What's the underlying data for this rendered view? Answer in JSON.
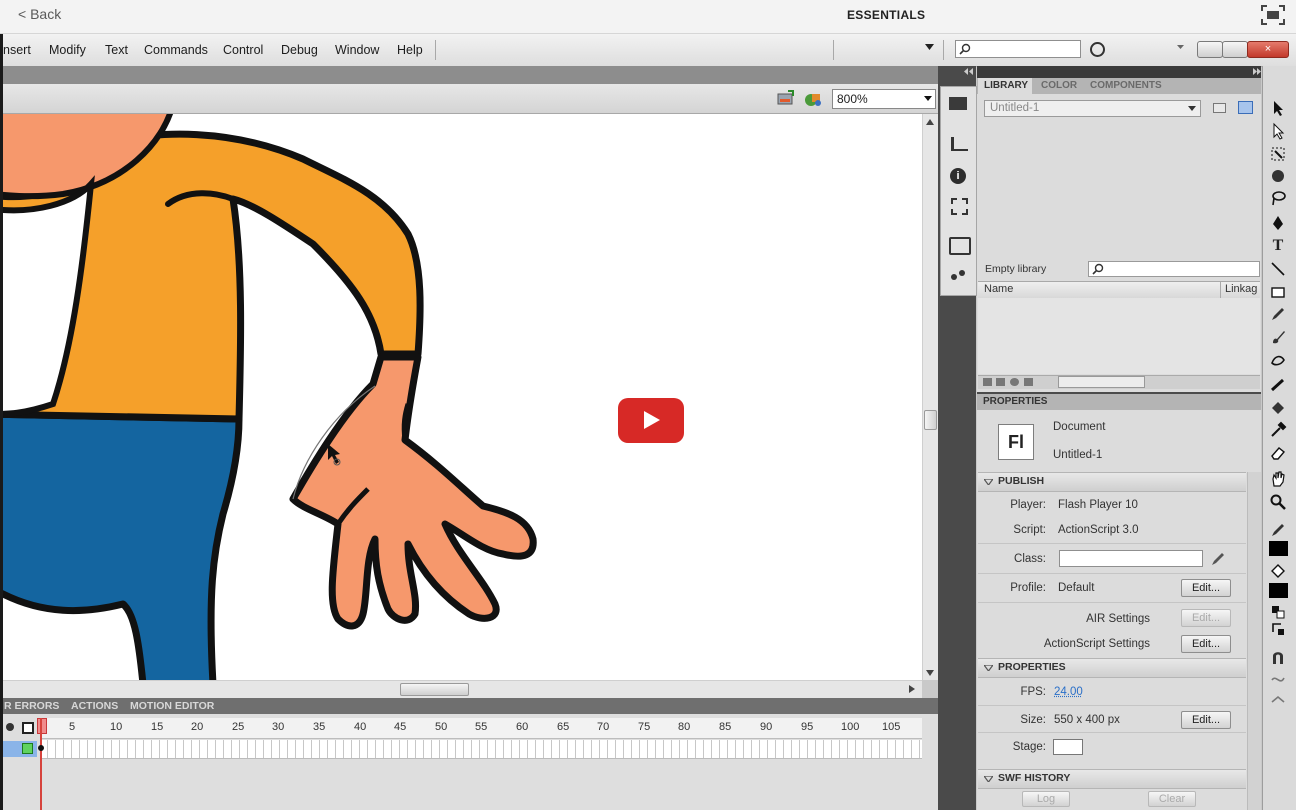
{
  "top": {
    "back_label": "< Back"
  },
  "menu": {
    "items": [
      "nsert",
      "Modify",
      "Text",
      "Commands",
      "Control",
      "Debug",
      "Window",
      "Help"
    ],
    "workspace": "ESSENTIALS",
    "close_glyph": "×"
  },
  "stage": {
    "zoom": "800%"
  },
  "timeline": {
    "tabs": [
      "R ERRORS",
      "ACTIONS",
      "MOTION EDITOR"
    ],
    "ticks": [
      "1",
      "5",
      "10",
      "15",
      "20",
      "25",
      "30",
      "35",
      "40",
      "45",
      "50",
      "55",
      "60",
      "65",
      "70",
      "75",
      "80",
      "85",
      "90",
      "95",
      "100",
      "105"
    ]
  },
  "library": {
    "tabs": [
      "LIBRARY",
      "COLOR",
      "COMPONENTS"
    ],
    "document": "Untitled-1",
    "empty_label": "Empty library",
    "col_name": "Name",
    "col_linkage": "Linkag"
  },
  "properties": {
    "header": "PROPERTIES",
    "doc_type": "Document",
    "doc_name": "Untitled-1",
    "icon_text": "Fl",
    "publish_title": "PUBLISH",
    "player_label": "Player:",
    "player_value": "Flash Player 10",
    "script_label": "Script:",
    "script_value": "ActionScript 3.0",
    "class_label": "Class:",
    "profile_label": "Profile:",
    "profile_value": "Default",
    "edit_label": "Edit...",
    "air_label": "AIR Settings",
    "as_label": "ActionScript Settings",
    "props_title": "PROPERTIES",
    "fps_label": "FPS:",
    "fps_value": "24.00",
    "size_label": "Size:",
    "size_value": "550 x 400 px",
    "stage_label": "Stage:",
    "swf_title": "SWF HISTORY",
    "log_label": "Log",
    "clear_label": "Clear"
  },
  "tools_text_glyph": "T",
  "colors": {
    "shirt": "#f5a02a",
    "skin": "#f6986c",
    "jeans": "#1465a0",
    "play_red": "#d72926"
  }
}
